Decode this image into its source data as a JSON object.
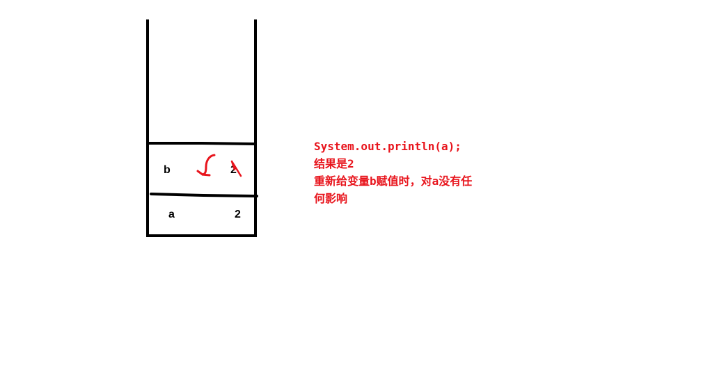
{
  "stack": {
    "rows": [
      {
        "variable": "b",
        "value": "2"
      },
      {
        "variable": "a",
        "value": "2"
      }
    ]
  },
  "annotation": {
    "lines": [
      "System.out.println(a);",
      "结果是2",
      "重新给变量b赋值时，对a没有任",
      "何影响"
    ]
  },
  "colors": {
    "ink": "#000000",
    "annotation": "#e8141c"
  }
}
